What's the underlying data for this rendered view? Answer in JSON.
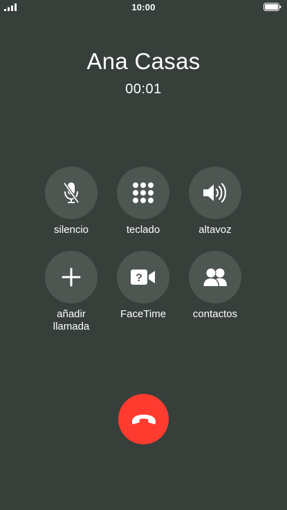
{
  "status_bar": {
    "time": "10:00",
    "signal_icon": "signal-bars-icon",
    "battery_icon": "battery-full-icon"
  },
  "call": {
    "caller_name": "Ana Casas",
    "duration": "00:01"
  },
  "controls": {
    "mute": {
      "label": "silencio",
      "icon": "microphone-muted-icon"
    },
    "keypad": {
      "label": "teclado",
      "icon": "keypad-icon"
    },
    "speaker": {
      "label": "altavoz",
      "icon": "speaker-icon"
    },
    "add_call": {
      "label_line1": "añadir",
      "label_line2": "llamada",
      "icon": "plus-icon"
    },
    "facetime": {
      "label": "FaceTime",
      "icon": "facetime-icon"
    },
    "contacts": {
      "label": "contactos",
      "icon": "contacts-icon"
    }
  },
  "end_call": {
    "icon": "hang-up-icon",
    "color": "#ff3b30"
  },
  "colors": {
    "background": "#373f3b",
    "button": "#4d5651",
    "end_call": "#ff3b30",
    "text": "#ffffff"
  }
}
